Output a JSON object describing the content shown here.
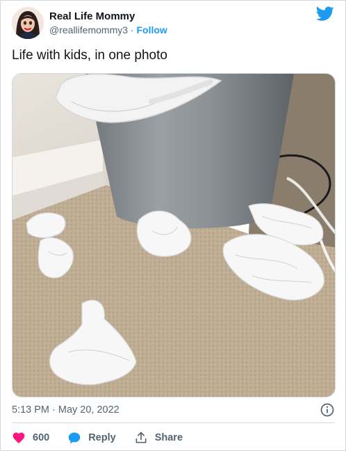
{
  "author": {
    "name": "Real Life Mommy",
    "handle": "@reallifemommy3",
    "separator": "·",
    "follow_label": "Follow"
  },
  "tweet": {
    "text": "Life with kids, in one photo",
    "timestamp": "5:13 PM · May 20, 2022"
  },
  "actions": {
    "like_count": "600",
    "reply_label": "Reply",
    "share_label": "Share"
  },
  "colors": {
    "brand": "#1d9bf0",
    "like": "#f91880",
    "muted": "#536471"
  },
  "icons": [
    "twitter-bird-icon",
    "info-icon",
    "heart-icon",
    "reply-icon",
    "share-icon"
  ]
}
